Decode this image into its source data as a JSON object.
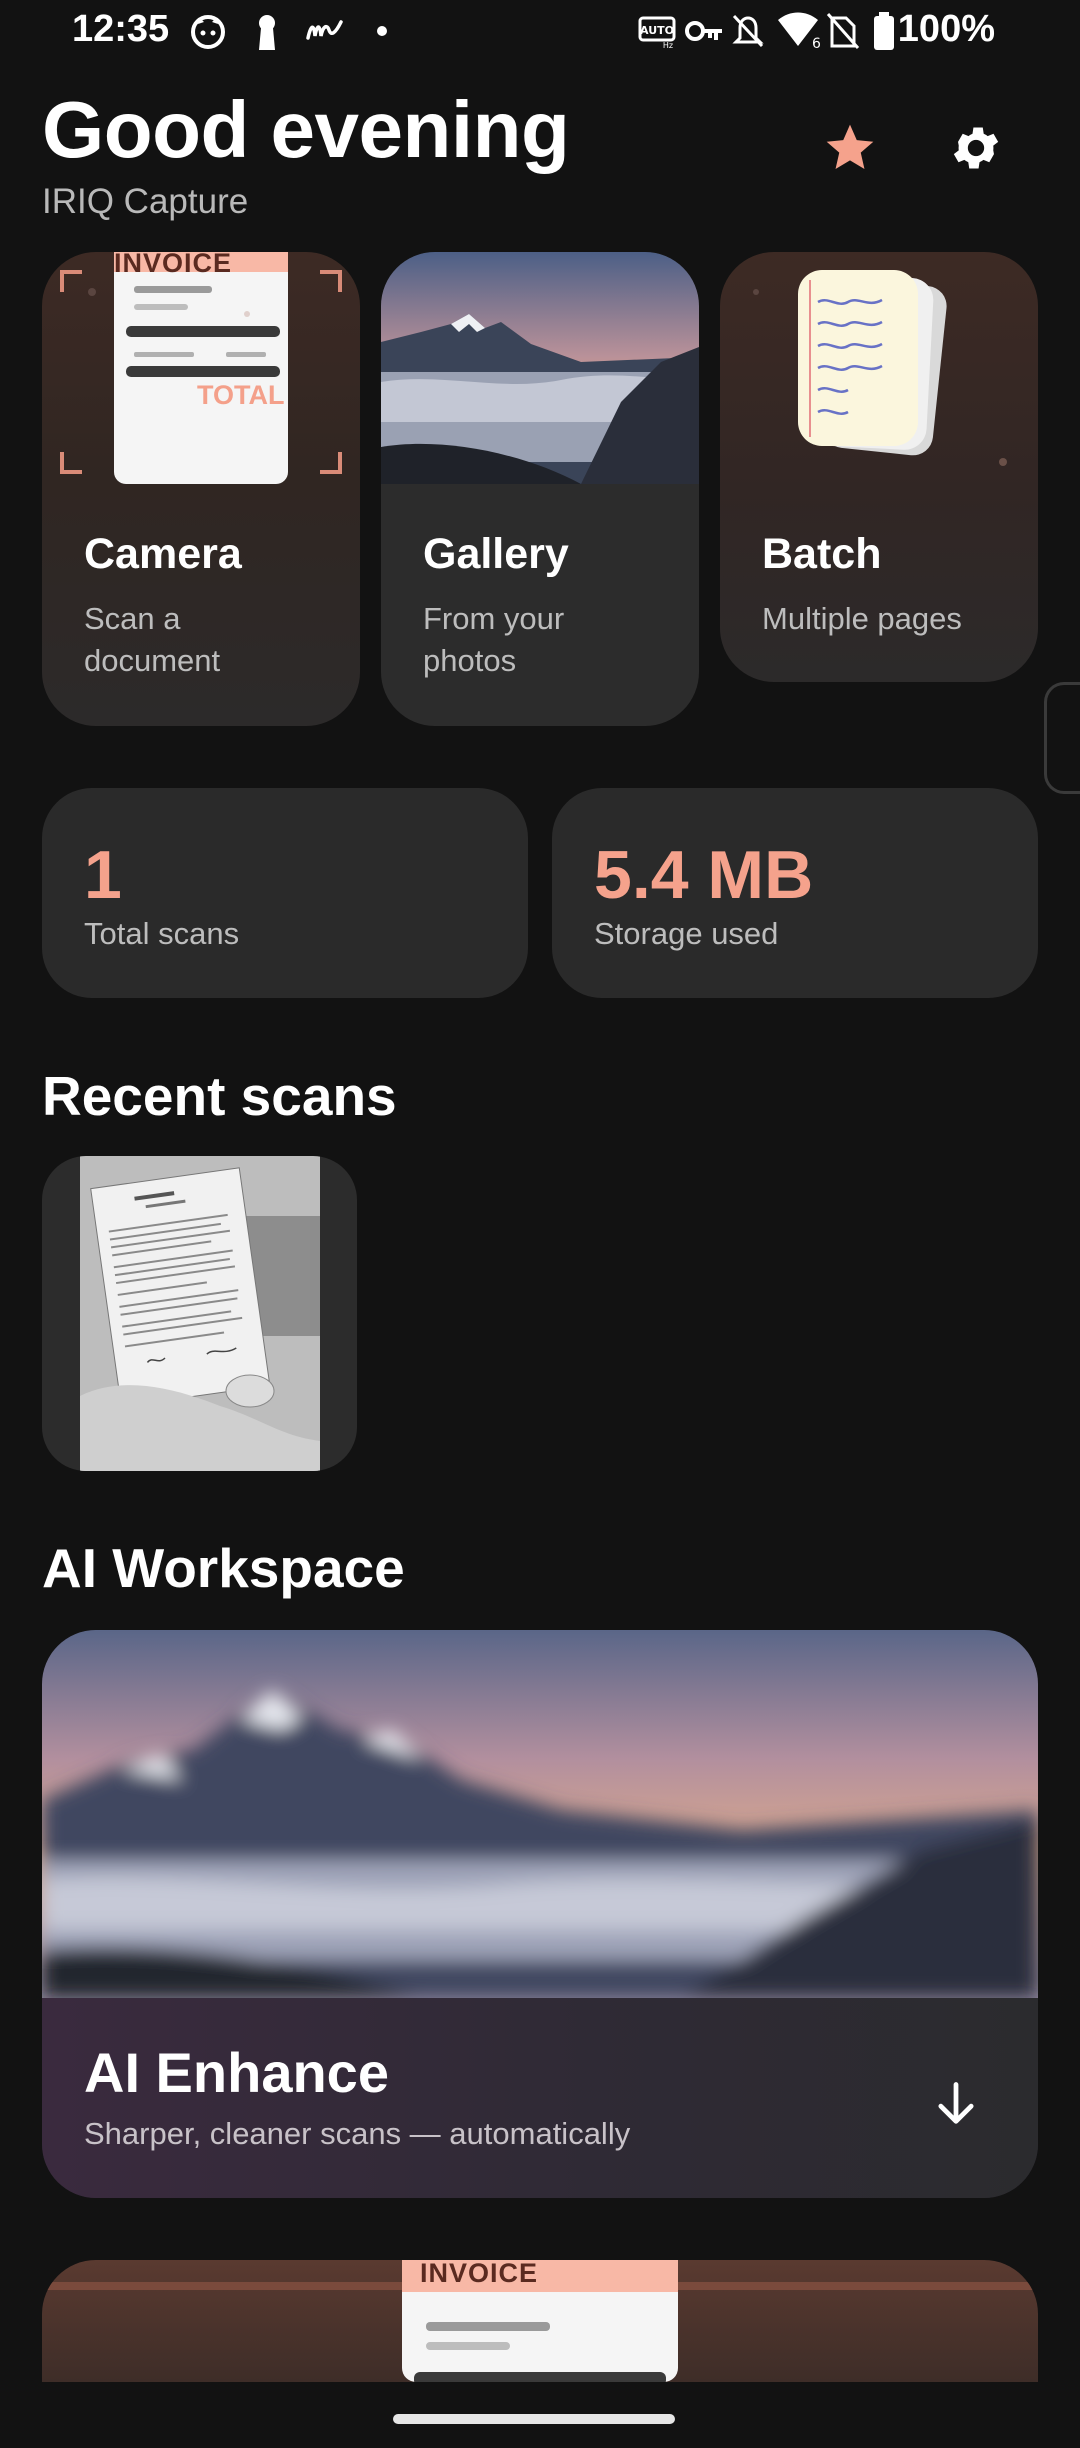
{
  "status_bar": {
    "time": "12:35",
    "battery": "100%",
    "icons": [
      "cat-notification-icon",
      "keyhole-icon",
      "my-app-icon",
      "dot-icon",
      "auto-hz-icon",
      "vpn-key-icon",
      "bell-off-icon",
      "wifi-icon",
      "no-sim-icon",
      "battery-icon"
    ]
  },
  "header": {
    "greeting": "Good evening",
    "app_name": "IRIQ Capture",
    "favorites_icon": "star-icon",
    "settings_icon": "gear-icon"
  },
  "actions": [
    {
      "title": "Camera",
      "subtitle_line1": "Scan a",
      "subtitle_line2": "document",
      "art_label": "INVOICE",
      "art_total": "TOTAL"
    },
    {
      "title": "Gallery",
      "subtitle_line1": "From your",
      "subtitle_line2": "photos"
    },
    {
      "title": "Batch",
      "subtitle_line1": "Multiple pages",
      "subtitle_line2": ""
    }
  ],
  "stats": [
    {
      "value": "1",
      "label": "Total scans"
    },
    {
      "value": "5.4 MB",
      "label": "Storage used"
    }
  ],
  "recent": {
    "title": "Recent scans"
  },
  "ai_workspace": {
    "title": "AI Workspace",
    "card_title": "AI Enhance",
    "card_subtitle": "Sharper, cleaner scans — automatically",
    "action_icon": "arrow-down-icon"
  },
  "next_card": {
    "art_label": "INVOICE"
  },
  "colors": {
    "accent": "#F5A28C",
    "background": "#121212",
    "card": "#2A2A2A"
  }
}
